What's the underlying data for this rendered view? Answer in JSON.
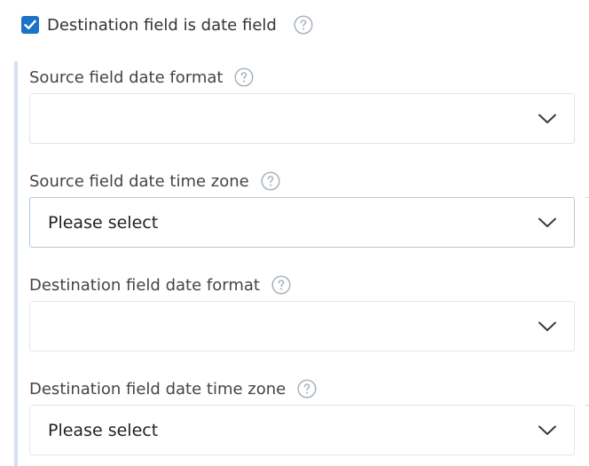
{
  "checkbox": {
    "label": "Destination field is date field",
    "checked": true
  },
  "fields": [
    {
      "label": "Source field date format",
      "value": ""
    },
    {
      "label": "Source field date time zone",
      "value": "Please select"
    },
    {
      "label": "Destination field date format",
      "value": ""
    },
    {
      "label": "Destination field date time zone",
      "value": "Please select"
    }
  ],
  "colors": {
    "accent": "#1a73c8",
    "help_icon": "#a9b2bb",
    "side_bar": "#d6e3ef"
  },
  "icons": {
    "help": "question-circle-icon",
    "dropdown": "chevron-down-icon",
    "check": "check-icon"
  }
}
